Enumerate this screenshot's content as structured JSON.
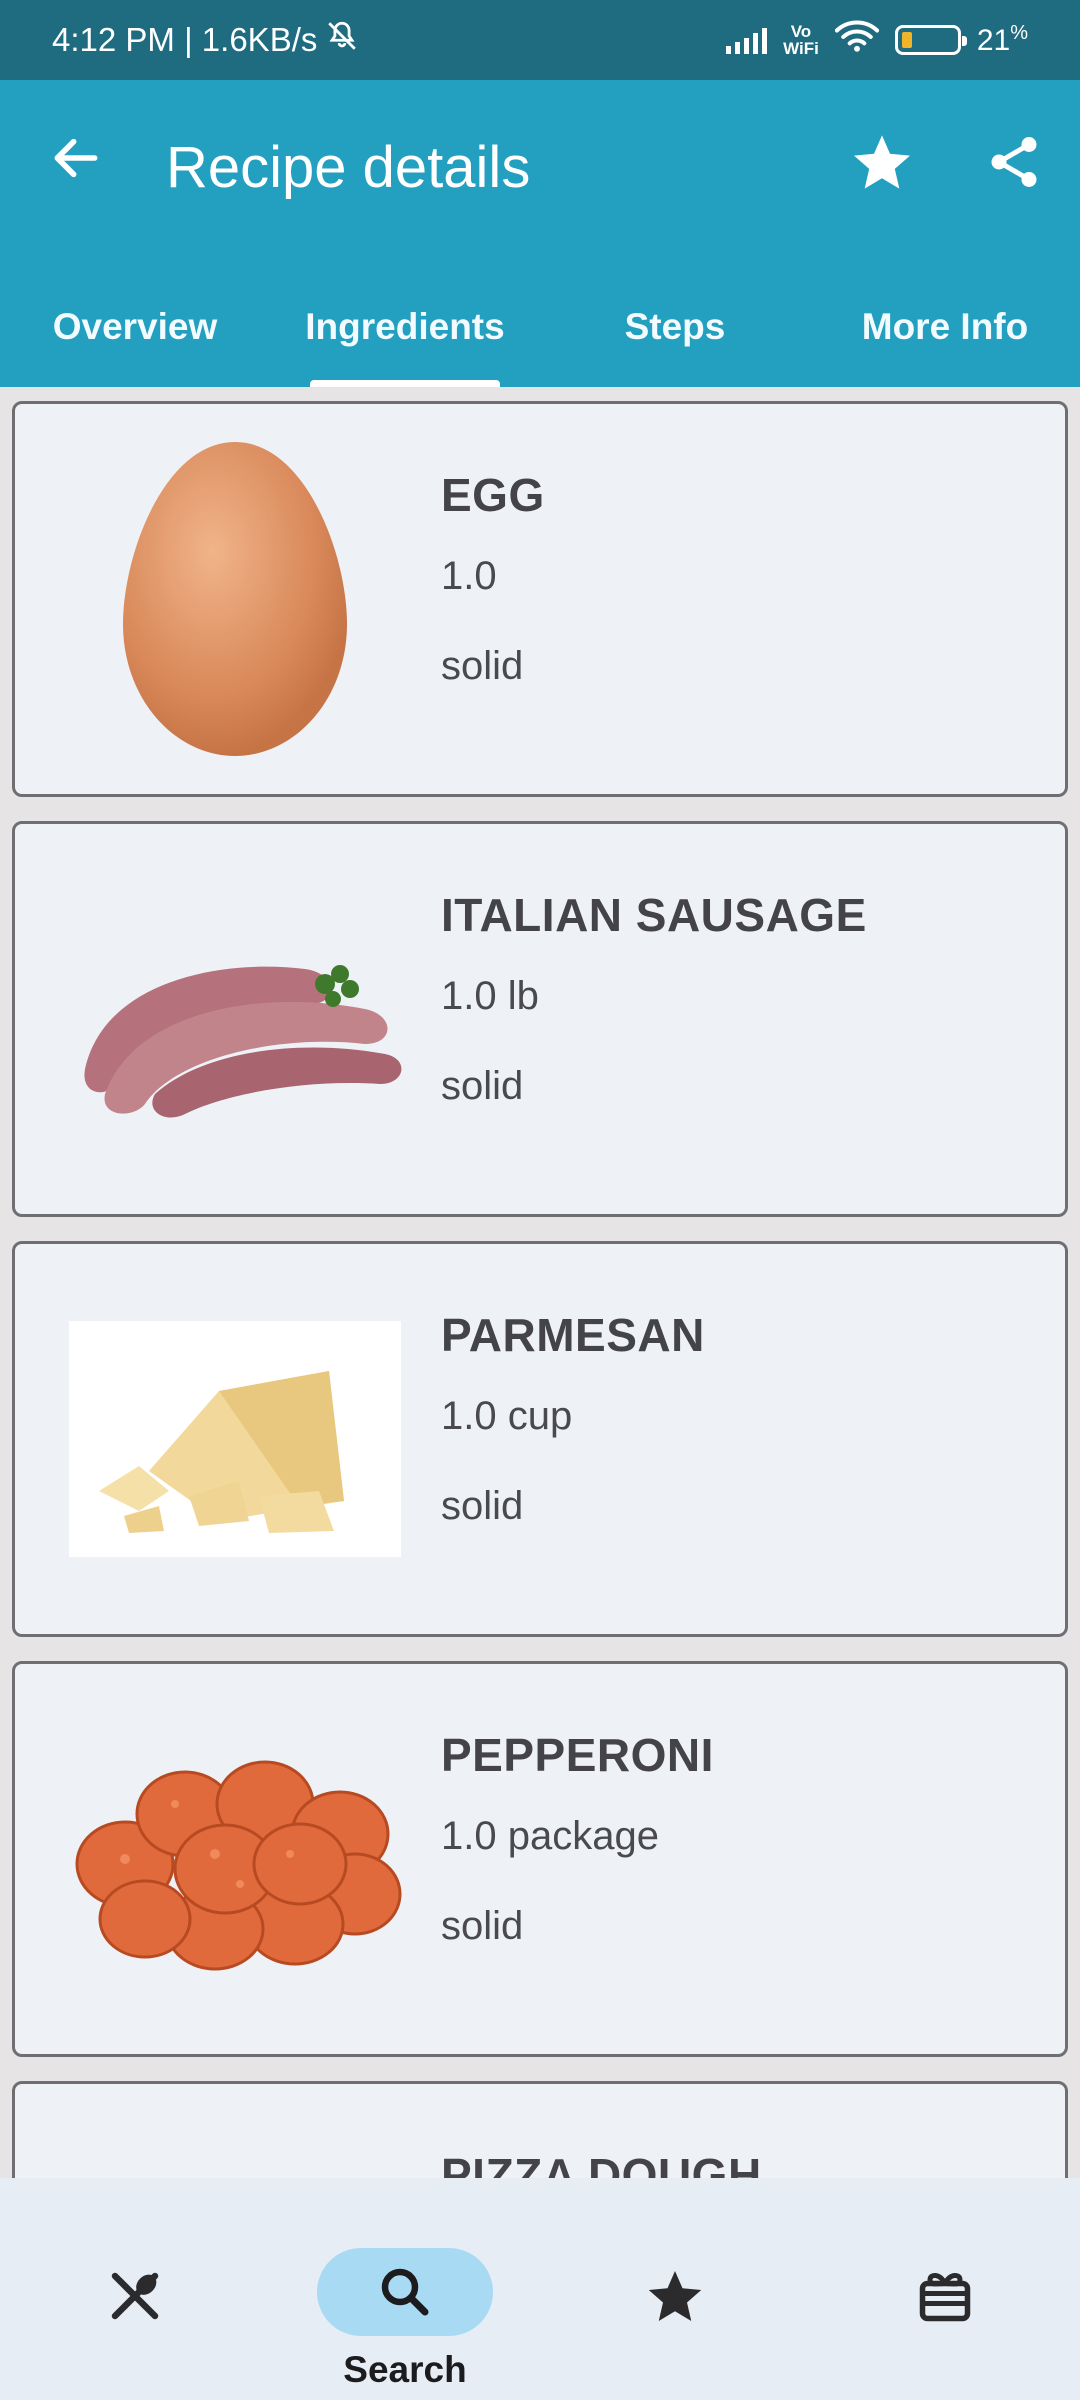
{
  "status_bar": {
    "time_speed": "4:12 PM | 1.6KB/s",
    "vowifi_top": "Vo",
    "vowifi_bottom": "WiFi",
    "battery_level": "21",
    "battery_unit": "%"
  },
  "app_bar": {
    "title": "Recipe details",
    "back_icon": "arrow-back-icon",
    "favorite_icon": "star-icon",
    "share_icon": "share-icon"
  },
  "tabs": [
    {
      "label": "Overview",
      "active": false
    },
    {
      "label": "Ingredients",
      "active": true
    },
    {
      "label": "Steps",
      "active": false
    },
    {
      "label": "More Info",
      "active": false
    }
  ],
  "ingredients": [
    {
      "name": "EGG",
      "quantity": "1.0",
      "type": "solid"
    },
    {
      "name": "ITALIAN SAUSAGE",
      "quantity": "1.0 lb",
      "type": "solid"
    },
    {
      "name": "PARMESAN",
      "quantity": "1.0 cup",
      "type": "solid"
    },
    {
      "name": "PEPPERONI",
      "quantity": "1.0 package",
      "type": "solid"
    },
    {
      "name": "PIZZA DOUGH",
      "quantity": "",
      "type": ""
    }
  ],
  "bottom_nav": {
    "items": [
      {
        "icon": "utensils-icon",
        "label": ""
      },
      {
        "icon": "search-icon",
        "label": "Search",
        "active": true
      },
      {
        "icon": "star-icon",
        "label": ""
      },
      {
        "icon": "gift-box-icon",
        "label": ""
      }
    ]
  },
  "colors": {
    "status_bar": "#1f6b80",
    "app_bar": "#239fc0",
    "card_bg": "#eef2f7",
    "nav_active_pill": "#a8dbf3"
  }
}
